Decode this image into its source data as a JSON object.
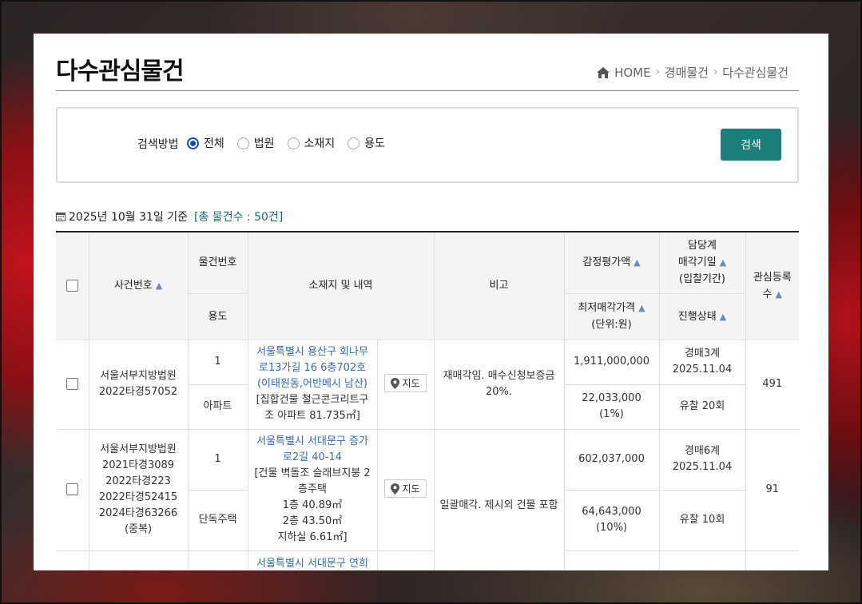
{
  "page": {
    "title": "다수관심물건",
    "breadcrumb": [
      "HOME",
      "경매물건",
      "다수관심물건"
    ]
  },
  "search": {
    "label": "검색방법",
    "options": [
      "전체",
      "법원",
      "소재지",
      "용도"
    ],
    "selected": "전체",
    "button": "검색"
  },
  "info": {
    "date_text": "2025년 10월 31일 기준",
    "count_text": "[총 물건수 : 50건]"
  },
  "table": {
    "headers": {
      "case_no": "사건번호",
      "item_no": "물건번호",
      "usage": "용도",
      "location": "소재지 및 내역",
      "note": "비고",
      "appraisal": "감정평가액",
      "min_price": "최저매각가격",
      "unit": "(단위:원)",
      "dept": "담당계",
      "sale_date": "매각기일",
      "bid_period": "(입찰기간)",
      "status": "진행상태",
      "interest_a": "관심등록",
      "interest_b": "수"
    },
    "rows": [
      {
        "court": "서울서부지방법원",
        "case_nos": [
          "2022타경57052"
        ],
        "item_no": "1",
        "usage": "아파트",
        "address": "서울특별시 용산구 회나무로13가길 16 6층702호 (이태원동,어반메시 남산)",
        "desc": "[집합건물 철근콘크리트구조 아파트 81.735㎡]",
        "desc_lines": [],
        "map_label": "지도",
        "note": "재매각임. 매수신청보증금 20%.",
        "appraisal": "1,911,000,000",
        "min_price": "22,033,000",
        "min_pct": "(1%)",
        "dept": "경매3계",
        "sale_date": "2025.11.04",
        "status": "유찰 20회",
        "interest": "491"
      },
      {
        "court": "서울서부지방법원",
        "case_nos": [
          "2021타경3089",
          "2022타경223",
          "2022타경52415",
          "2024타경63266",
          "(중복)"
        ],
        "item_no": "1",
        "usage": "단독주택",
        "address": "서울특별시 서대문구 증가로2길 40-14",
        "desc": "[건물 벽돌조 슬래브지붕 2층주택",
        "desc_lines": [
          "1층 40.89㎡",
          "2층 43.50㎡",
          "지하실 6.61㎡]"
        ],
        "map_label": "지도",
        "note": "일괄매각. 제시외 건물 포함",
        "appraisal": "602,037,000",
        "min_price": "64,643,000",
        "min_pct": "(10%)",
        "dept": "경매6계",
        "sale_date": "2025.11.04",
        "status": "유찰 10회",
        "interest": "91"
      }
    ],
    "partial_row_address": "서울특별시 서대문구 연희"
  }
}
